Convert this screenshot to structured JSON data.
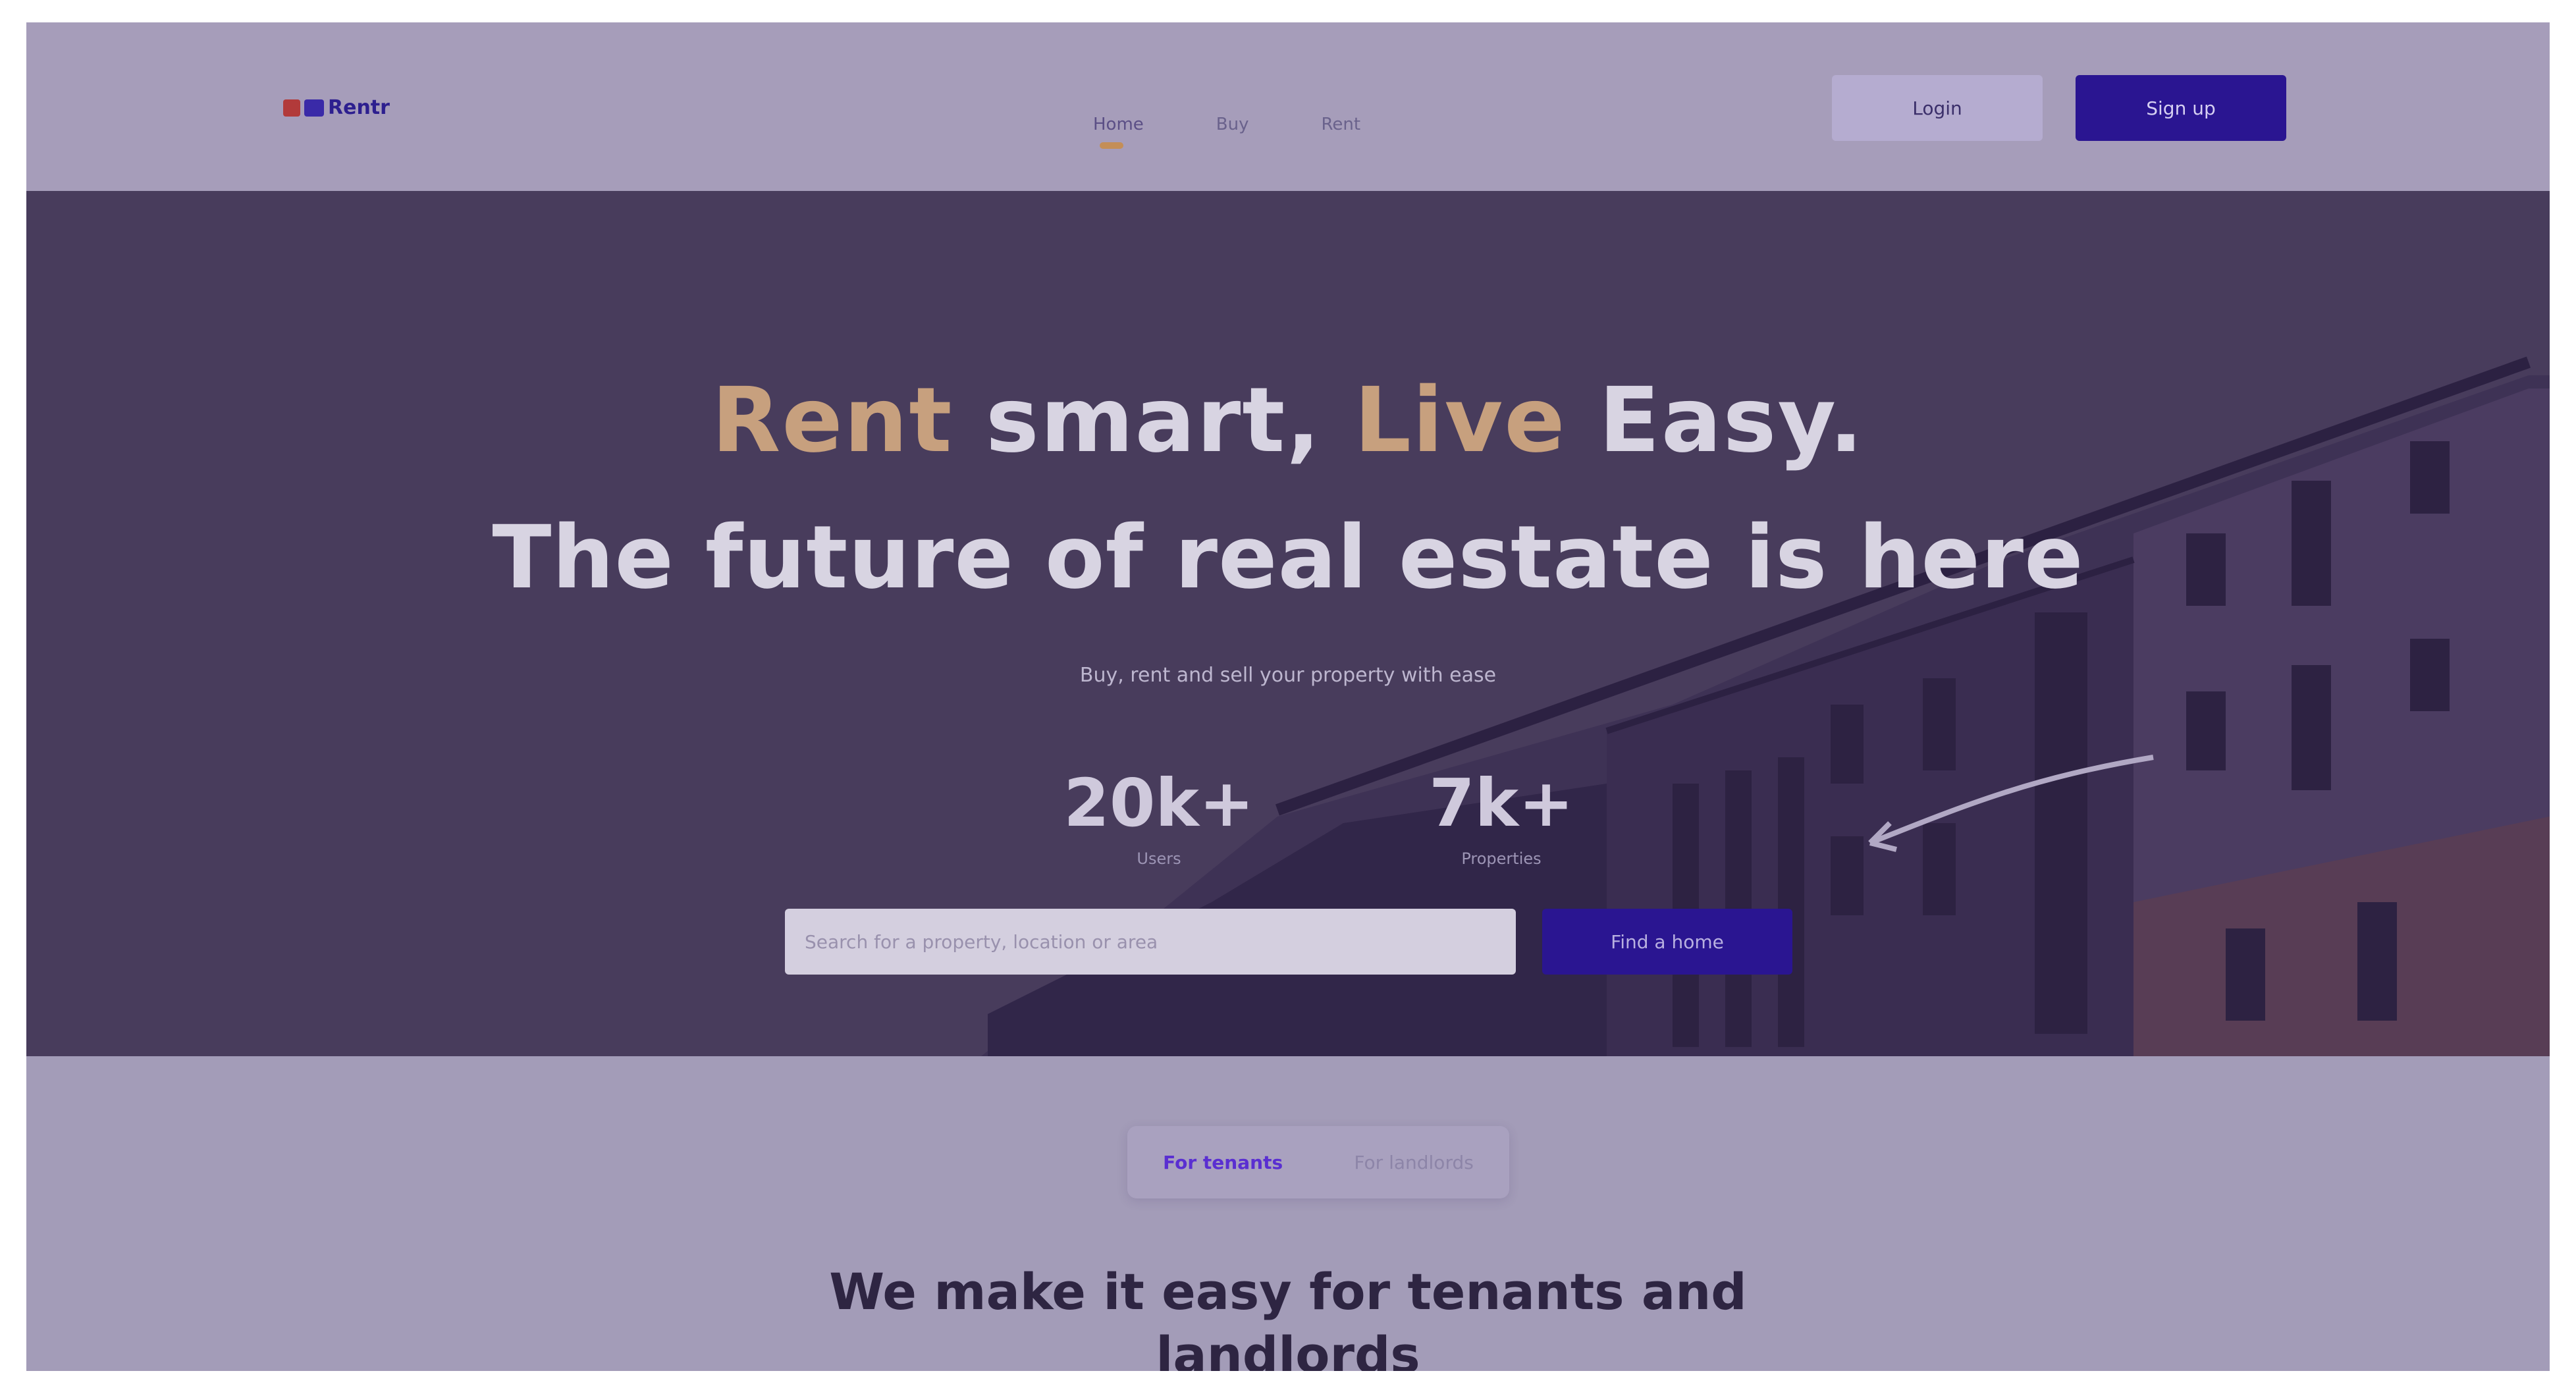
{
  "nav": {
    "logo_text": "Rentr",
    "links": [
      {
        "label": "Home"
      },
      {
        "label": "Buy"
      },
      {
        "label": "Rent"
      }
    ],
    "login_label": "Login",
    "signup_label": "Sign up"
  },
  "hero": {
    "line1_a": "Rent",
    "line1_b": " smart, ",
    "line1_c": "Live",
    "line1_d": " Easy.",
    "line2": "The future of real estate is here",
    "subtitle": "Buy, rent and sell your property with ease",
    "stats": [
      {
        "value": "20k+",
        "label": "Users"
      },
      {
        "value": "7k+",
        "label": "Properties"
      }
    ],
    "search_placeholder": "Search for a property, location or area",
    "search_button": "Find a home"
  },
  "tabs": [
    {
      "label": "For tenants"
    },
    {
      "label": "For landlords"
    }
  ],
  "section": {
    "title_line1": "We make it easy for tenants and",
    "title_line2": "landlords"
  },
  "colors": {
    "accent_gold": "#c7a07e",
    "primary_indigo": "#2a1591",
    "hero_bg": "#483c5c",
    "page_bg": "#a39cb8"
  }
}
